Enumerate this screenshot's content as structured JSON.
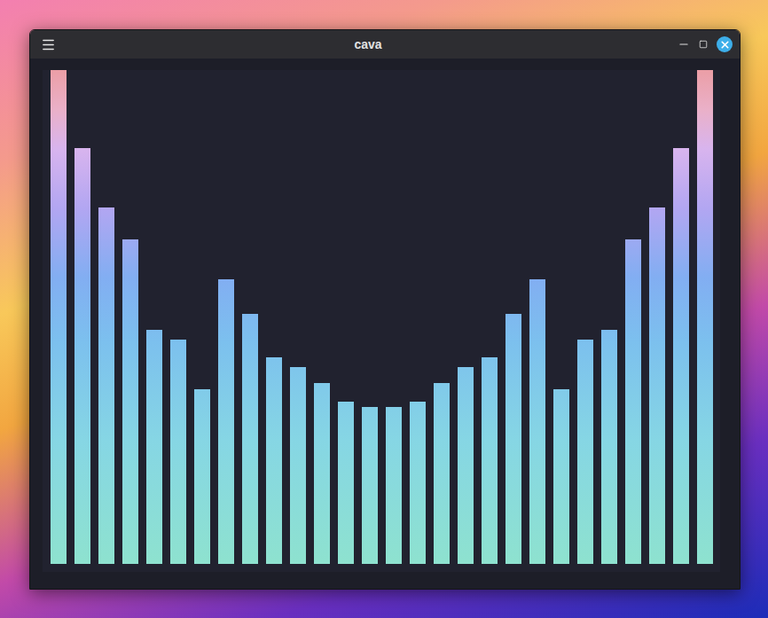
{
  "window": {
    "title": "cava"
  },
  "chart": {
    "bars": [
      1,
      0.842,
      0.722,
      0.657,
      0.474,
      0.454,
      0.354,
      0.576,
      0.506,
      0.418,
      0.399,
      0.366,
      0.329,
      0.318,
      0.318,
      0.329,
      0.366,
      0.399,
      0.418,
      0.506,
      0.576,
      0.354,
      0.454,
      0.474,
      0.657,
      0.722,
      0.842,
      1
    ]
  }
}
